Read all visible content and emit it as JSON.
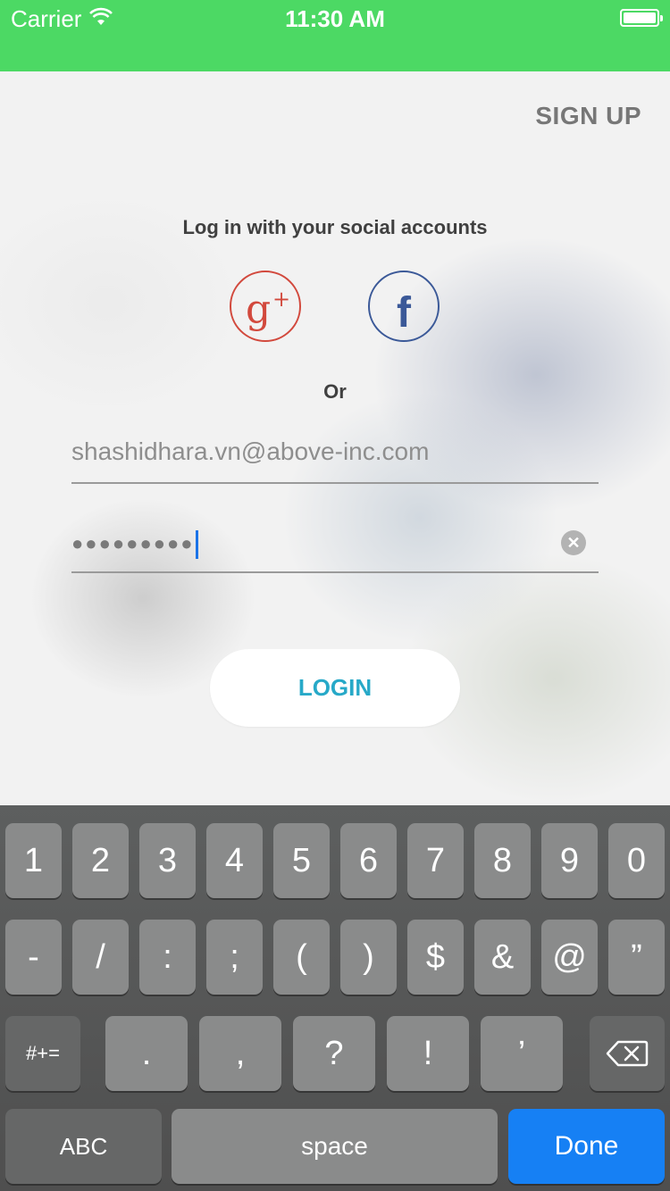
{
  "status_bar": {
    "carrier": "Carrier",
    "time": "11:30 AM"
  },
  "header": {
    "signup_label": "SIGN UP"
  },
  "social": {
    "heading": "Log in with your social accounts",
    "google_icon": "google-plus-icon",
    "facebook_icon": "facebook-icon"
  },
  "divider": {
    "or_text": "Or"
  },
  "form": {
    "email_value": "shashidhara.vn@above-inc.com",
    "password_masked": "●●●●●●●●●"
  },
  "login": {
    "label": "LOGIN"
  },
  "colors": {
    "status_bar": "#4cd964",
    "google": "#d2493d",
    "facebook": "#3b5998",
    "login_text": "#27a9c8",
    "done_key": "#1680f4"
  },
  "keyboard": {
    "row1": [
      "1",
      "2",
      "3",
      "4",
      "5",
      "6",
      "7",
      "8",
      "9",
      "0"
    ],
    "row2": [
      "-",
      "/",
      ":",
      ";",
      "(",
      ")",
      "$",
      "&",
      "@",
      "”"
    ],
    "row3_left": "#+=",
    "row3": [
      ".",
      ",",
      "?",
      "!",
      "’"
    ],
    "row3_right_icon": "backspace-icon",
    "abc": "ABC",
    "space": "space",
    "done": "Done"
  }
}
